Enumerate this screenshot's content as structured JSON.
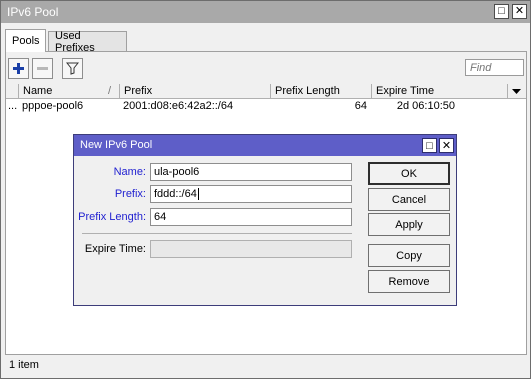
{
  "window": {
    "title": "IPv6 Pool",
    "restore_glyph": "□",
    "close_glyph": "✕"
  },
  "tabs": [
    {
      "label": "Pools",
      "active": true
    },
    {
      "label": "Used Prefixes",
      "active": false
    }
  ],
  "toolbar": {
    "add_icon": "plus-icon",
    "remove_icon": "minus-icon",
    "filter_icon": "filter-icon",
    "find_placeholder": "Find"
  },
  "table": {
    "columns": [
      "Name",
      "Prefix",
      "Prefix Length",
      "Expire Time"
    ],
    "rows": [
      {
        "marker": "...",
        "name": "pppoe-pool6",
        "prefix": "2001:d08:e6:42a2::/64",
        "prefix_length": "64",
        "expire_time": "2d 06:10:50"
      }
    ]
  },
  "status": {
    "count": "1 item"
  },
  "dialog": {
    "title": "New IPv6 Pool",
    "fields": {
      "name_label": "Name:",
      "name_value": "ula-pool6",
      "prefix_label": "Prefix:",
      "prefix_value": "fddd::/64",
      "prefix_length_label": "Prefix Length:",
      "prefix_length_value": "64",
      "expire_time_label": "Expire Time:",
      "expire_time_value": ""
    },
    "buttons": {
      "ok": "OK",
      "cancel": "Cancel",
      "apply": "Apply",
      "copy": "Copy",
      "remove": "Remove"
    }
  },
  "colors": {
    "dialog_titlebar": "#5e5ec8",
    "window_titlebar": "#a9a9a9",
    "label_blue": "#1f1fd0"
  }
}
